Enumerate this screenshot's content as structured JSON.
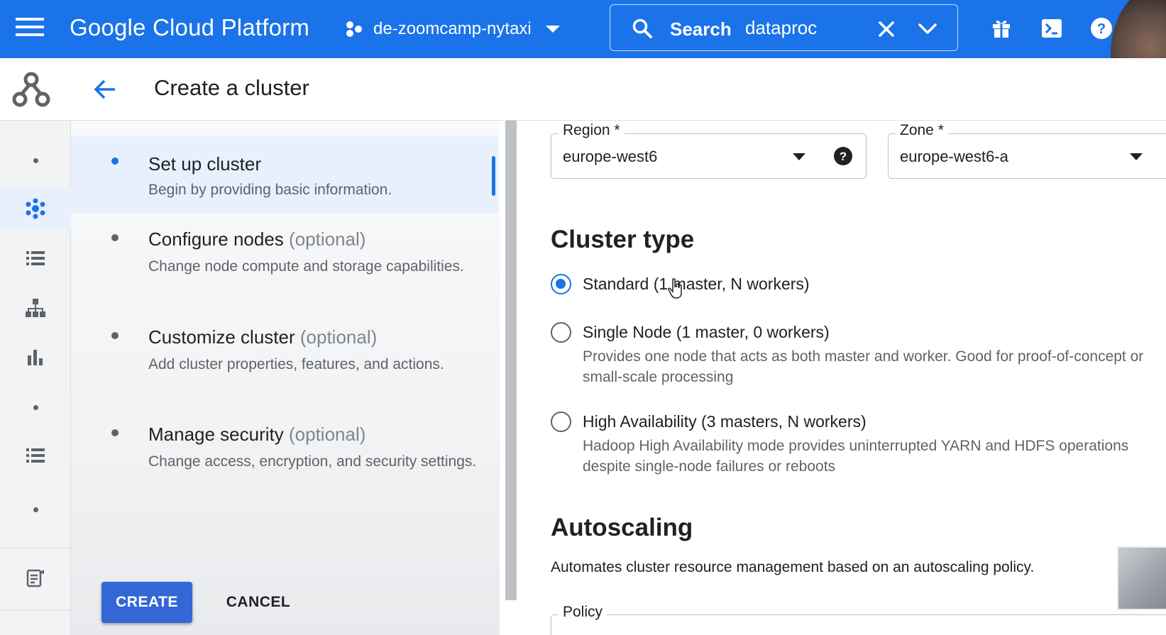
{
  "topbar": {
    "brand": "Google Cloud Platform",
    "project": "de-zoomcamp-nytaxi",
    "search_label": "Search",
    "search_value": "dataproc",
    "accent": "#1a73e8"
  },
  "header": {
    "title": "Create a cluster"
  },
  "rail": {
    "items": [
      "dataproc-logo",
      "dot",
      "clusters-icon",
      "list-icon",
      "hierarchy-icon",
      "bar-chart-icon",
      "dot",
      "list-icon",
      "dot",
      "notes-icon"
    ]
  },
  "stepper": {
    "steps": [
      {
        "title": "Set up cluster",
        "optional": "",
        "desc": "Begin by providing basic information."
      },
      {
        "title": "Configure nodes",
        "optional": "(optional)",
        "desc": "Change node compute and storage capabilities."
      },
      {
        "title": "Customize cluster",
        "optional": "(optional)",
        "desc": "Add cluster properties, features, and actions."
      },
      {
        "title": "Manage security",
        "optional": "(optional)",
        "desc": "Change access, encryption, and security settings."
      }
    ],
    "create_label": "CREATE",
    "cancel_label": "CANCEL"
  },
  "form": {
    "region": {
      "label": "Region *",
      "value": "europe-west6"
    },
    "zone": {
      "label": "Zone *",
      "value": "europe-west6-a"
    },
    "cluster_type": {
      "title": "Cluster type",
      "options": [
        {
          "label": "Standard (1 master, N workers)",
          "desc": "",
          "checked": true
        },
        {
          "label": "Single Node (1 master, 0 workers)",
          "desc": "Provides one node that acts as both master and worker. Good for proof-of-concept or small-scale processing",
          "checked": false
        },
        {
          "label": "High Availability (3 masters, N workers)",
          "desc": "Hadoop High Availability mode provides uninterrupted YARN and HDFS operations despite single-node failures or reboots",
          "checked": false
        }
      ]
    },
    "autoscaling": {
      "title": "Autoscaling",
      "desc": "Automates cluster resource management based on an autoscaling policy.",
      "policy_label": "Policy"
    }
  }
}
